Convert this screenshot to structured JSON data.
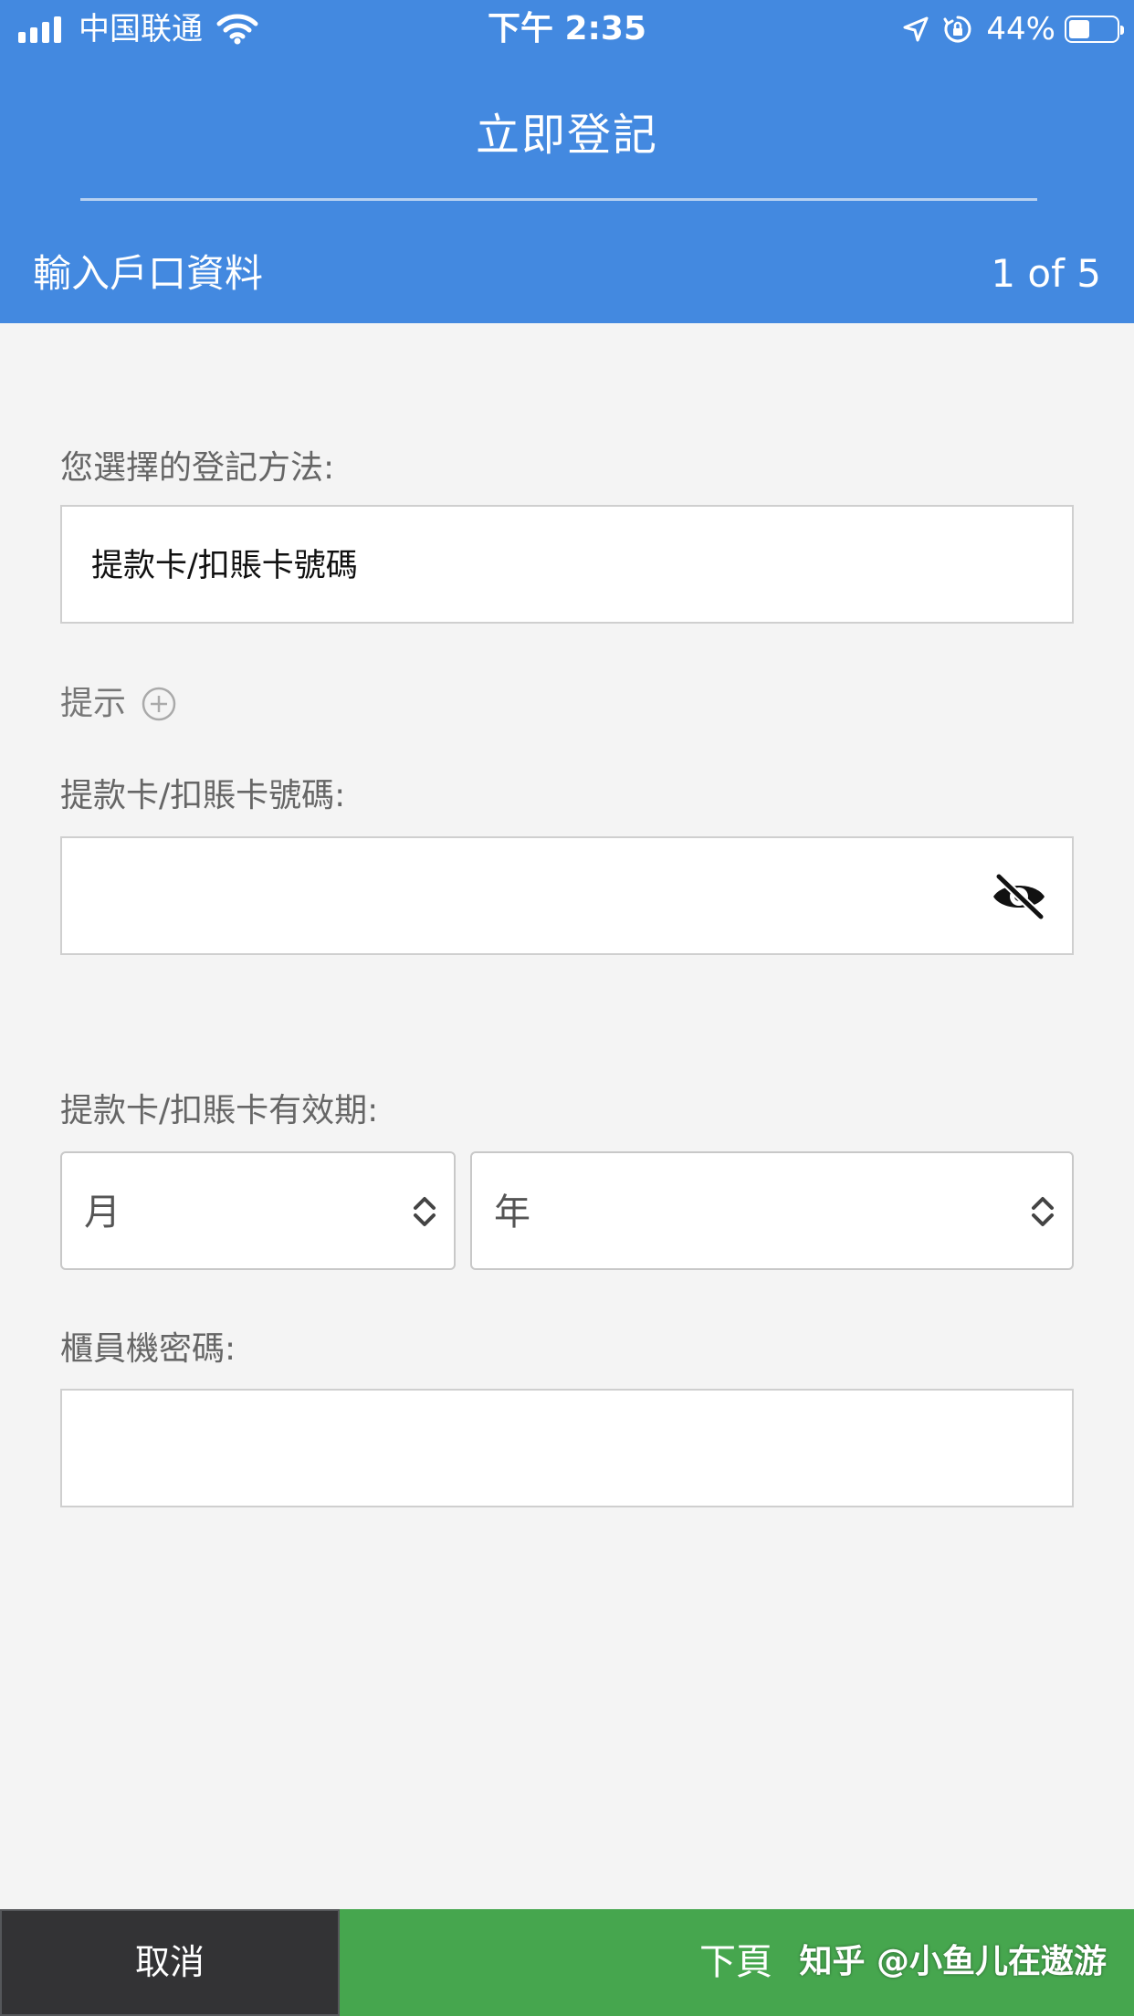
{
  "status_bar": {
    "carrier": "中国联通",
    "time": "下午 2:35",
    "battery_percent": "44%",
    "battery_level": 0.44
  },
  "header": {
    "title": "立即登記",
    "step_label": "輸入戶口資料",
    "step_count": "1 of 5"
  },
  "form": {
    "method_label": "您選擇的登記方法:",
    "method_value": "提款卡/扣賬卡號碼",
    "hint_label": "提示",
    "card_number_label": "提款卡/扣賬卡號碼:",
    "card_number_value": "",
    "expiry_label": "提款卡/扣賬卡有效期:",
    "expiry_month": "月",
    "expiry_year": "年",
    "pin_label": "櫃員機密碼:",
    "pin_value": ""
  },
  "footer": {
    "cancel_label": "取消",
    "next_label": "下頁",
    "watermark": "知乎 @小鱼儿在遨游"
  },
  "icons": {
    "signal": "signal-bars-icon",
    "wifi": "wifi-icon",
    "location": "location-arrow-icon",
    "rotation_lock": "rotation-lock-icon",
    "battery": "battery-icon",
    "hint_expand": "plus-circle-icon",
    "visibility": "eye-slash-icon",
    "select": "chevron-up-down-icon"
  },
  "colors": {
    "header_blue": "#4389e0",
    "next_green": "#46a64e",
    "cancel_dark": "#333335",
    "page_bg": "#f4f4f4"
  }
}
